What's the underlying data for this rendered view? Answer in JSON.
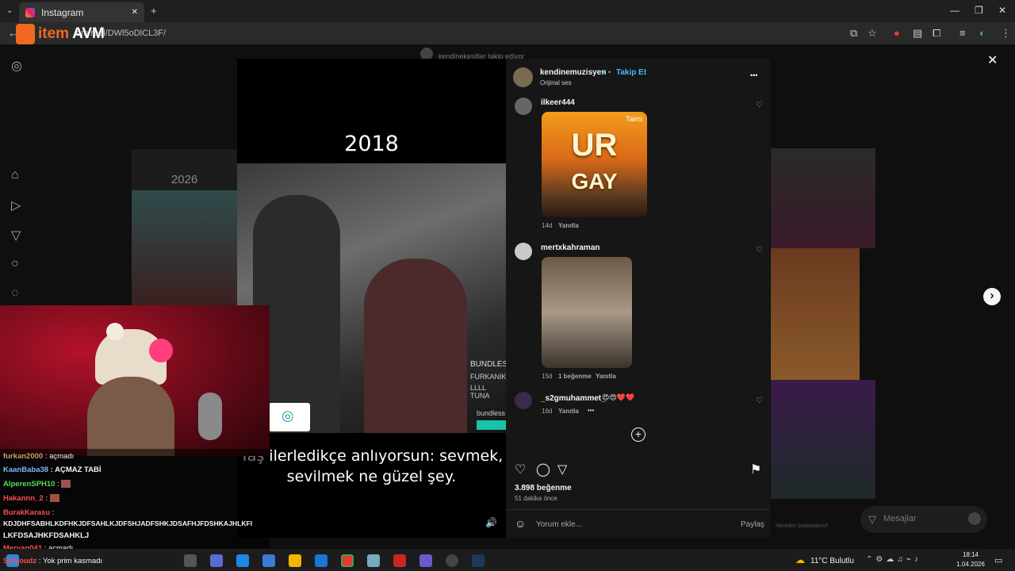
{
  "browser": {
    "tab_title": "Instagram",
    "url": "om/reel/DWl5oDlCL3F/",
    "new_tab": "+",
    "close_tab": "✕"
  },
  "overlay_logo": {
    "part1": "item",
    "part2": "AVM"
  },
  "page": {
    "follow_notice": "kendinekesitler takip ediyor",
    "prev_year": "2026",
    "close_label": "✕",
    "next_label": "›"
  },
  "video": {
    "year": "2018",
    "caption_line1": "Yaş ilerledikçe anlıyorsun: sevmek,",
    "caption_line2": "sevilmek ne güzel şey.",
    "bundle_text": "BUNDLES",
    "bundle_sub": "FURKANIK",
    "bundle_sub2": "LLLL TUNA",
    "side_text": "bundless"
  },
  "post": {
    "author": "kendinemuzisyen",
    "follow": "Takip Et",
    "audio": "Orijinal ses",
    "more": "•••",
    "likes": "3.898 beğenme",
    "time": "51 dakika önce",
    "comment_placeholder": "Yorum ekle...",
    "share": "Paylaş"
  },
  "comments": [
    {
      "user": "ilkeer444",
      "time": "14d",
      "reply": "Yanıtla",
      "gif_top": "UR",
      "gif_bottom": "GAY",
      "gif_tag": "Taimi"
    },
    {
      "user": "mertxkahraman",
      "time": "15d",
      "likes": "1 beğenme",
      "reply": "Yanıtla"
    },
    {
      "user": "_s2gmuhammet_",
      "text": "😍😍❤️❤️",
      "time": "16d",
      "reply": "Yanıtla",
      "more": "•••"
    }
  ],
  "right_panel": {
    "messages": "Mesajlar",
    "typing_hint": "Nereden başlayalım?"
  },
  "chat": [
    {
      "name": "furkan2000",
      "msg": ": açmadı",
      "color": "#c8a060"
    },
    {
      "name": "KaanBaba38",
      "msg": ": AÇMAZ TABİ",
      "color": "#7fb8ff"
    },
    {
      "name": "AlperenSPH10",
      "msg": ":",
      "color": "#55dd55"
    },
    {
      "name": "Hakannn_2",
      "msg": ":",
      "color": "#ff4d4d"
    },
    {
      "name": "BurakKarasu",
      "msg": ":",
      "color": "#ff4d4d"
    },
    {
      "name": "",
      "msg": "KDJDHFSABHLKDFHKJDFSAHLKJDFSHJADFSHKJDSAFHJFDSHKAJHLKFI",
      "color": "#ffffff"
    },
    {
      "name": "",
      "msg": "LKFDSAJHKFDSAHKLJ",
      "color": "#ffffff"
    },
    {
      "name": "Mervan041",
      "msg": ": açmadı",
      "color": "#ff4d4d"
    },
    {
      "name": "Sefyoudz",
      "msg": ": Yok prim kasmadı",
      "color": "#ff4d4d"
    }
  ],
  "taskbar": {
    "weather": "11°C  Bulutlu",
    "time": "18:14",
    "date": "1.04.2026"
  },
  "colors": {
    "instagram_blue": "#4cb5f9",
    "panel_bg": "#161616",
    "logo_orange": "#ef6a1e"
  },
  "icons": [
    "home-icon",
    "reels-icon",
    "send-icon",
    "search-icon",
    "explore-icon",
    "heart-icon",
    "comment-icon",
    "share-icon",
    "bookmark-icon",
    "emoji-icon"
  ]
}
